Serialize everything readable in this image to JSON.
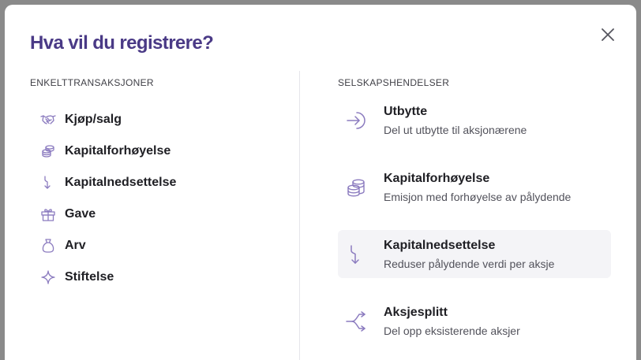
{
  "modal": {
    "title": "Hva vil du registrere?"
  },
  "left": {
    "heading": "ENKELTTRANSAKSJONER",
    "items": [
      {
        "label": "Kjøp/salg",
        "icon": "handshake-icon"
      },
      {
        "label": "Kapitalforhøyelse",
        "icon": "coins-icon"
      },
      {
        "label": "Kapitalnedsettelse",
        "icon": "arrow-down-icon"
      },
      {
        "label": "Gave",
        "icon": "gift-icon"
      },
      {
        "label": "Arv",
        "icon": "money-bag-icon"
      },
      {
        "label": "Stiftelse",
        "icon": "sparkle-icon"
      }
    ]
  },
  "right": {
    "heading": "SELSKAPSHENDELSER",
    "items": [
      {
        "title": "Utbytte",
        "desc": "Del ut utbytte til aksjonærene",
        "icon": "arrow-in-icon"
      },
      {
        "title": "Kapitalforhøyelse",
        "desc": "Emisjon med forhøyelse av pålydende",
        "icon": "coins-icon"
      },
      {
        "title": "Kapitalnedsettelse",
        "desc": "Reduser pålydende verdi per aksje",
        "icon": "arrow-down-icon"
      },
      {
        "title": "Aksjesplitt",
        "desc": "Del opp eksisterende aksjer",
        "icon": "split-icon"
      }
    ]
  },
  "colors": {
    "accent": "#4a3a86",
    "icon": "#8b7bbf",
    "hover_bg": "#f4f4f7"
  }
}
